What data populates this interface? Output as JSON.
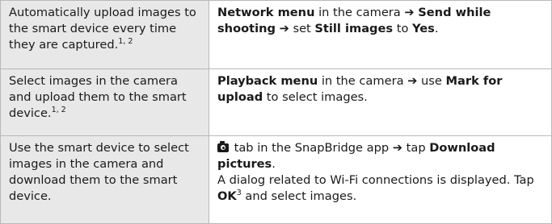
{
  "rows": [
    {
      "task": "Automatically upload images to the smart device every time they are captured.",
      "task_notes": "1, 2",
      "steps": {
        "menu": "Network menu",
        "in_camera": " in the camera ",
        "item1": "Send while shooting",
        "set": " set ",
        "item2": "Still images",
        "to": " to ",
        "value": "Yes",
        "end": "."
      }
    },
    {
      "task": "Select images in the camera and upload them to the smart device.",
      "task_notes": "1, 2",
      "steps": {
        "menu": "Playback menu",
        "in_camera": " in the camera ",
        "use": " use ",
        "item": "Mark for upload",
        "end": " to select images."
      }
    },
    {
      "task": "Use the smart device to select images in the camera and download them to the smart device.",
      "steps": {
        "camera_icon": "camera-icon",
        "tab_text": " tab in the SnapBridge app ",
        "tap": " tap ",
        "item": "Download pictures",
        "end": ".",
        "dialog": "A dialog related to Wi-Fi connections is displayed. Tap ",
        "ok": "OK",
        "ok_note": "3",
        "select": " and select images."
      }
    }
  ],
  "arrow_glyph": "➔"
}
